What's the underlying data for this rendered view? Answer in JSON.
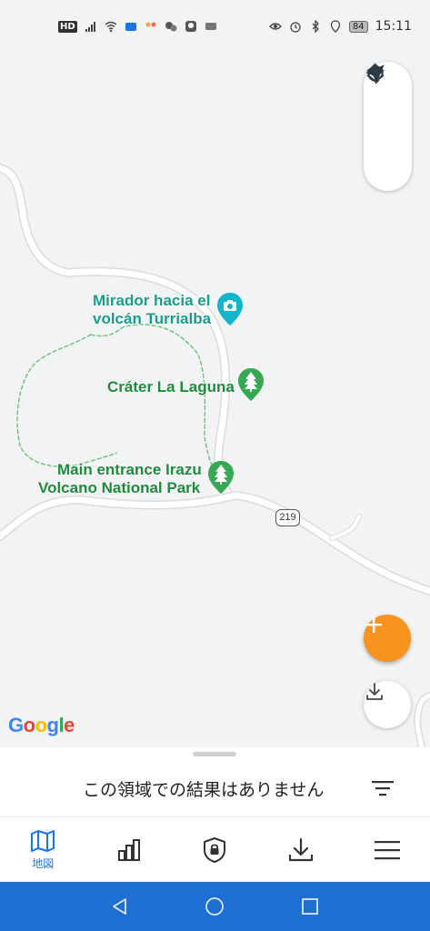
{
  "status_bar": {
    "hd_badge": "HD",
    "battery": "84",
    "time": "15:11"
  },
  "map": {
    "places": [
      {
        "line1": "Mirador hacia el",
        "line2": "volcán Turrialba",
        "type": "camera"
      },
      {
        "line1": "Cráter La Laguna",
        "type": "park"
      },
      {
        "line1": "Main entrance Irazu",
        "line2": "Volcano National Park",
        "type": "park"
      }
    ],
    "road_number": "219",
    "attribution": "Google"
  },
  "sheet": {
    "message": "この領域での結果はありません"
  },
  "tabs": [
    {
      "label": "地図",
      "icon": "map-icon",
      "active": true
    },
    {
      "label": "",
      "icon": "stats-icon"
    },
    {
      "label": "",
      "icon": "lock-shield-icon"
    },
    {
      "label": "",
      "icon": "download-icon"
    },
    {
      "label": "",
      "icon": "menu-icon"
    }
  ],
  "colors": {
    "accent": "#1a73e8",
    "fab": "#f7931e",
    "navbar": "#1d6fd4",
    "place_teal": "#1a9e8a",
    "place_green": "#1e8a3c"
  }
}
